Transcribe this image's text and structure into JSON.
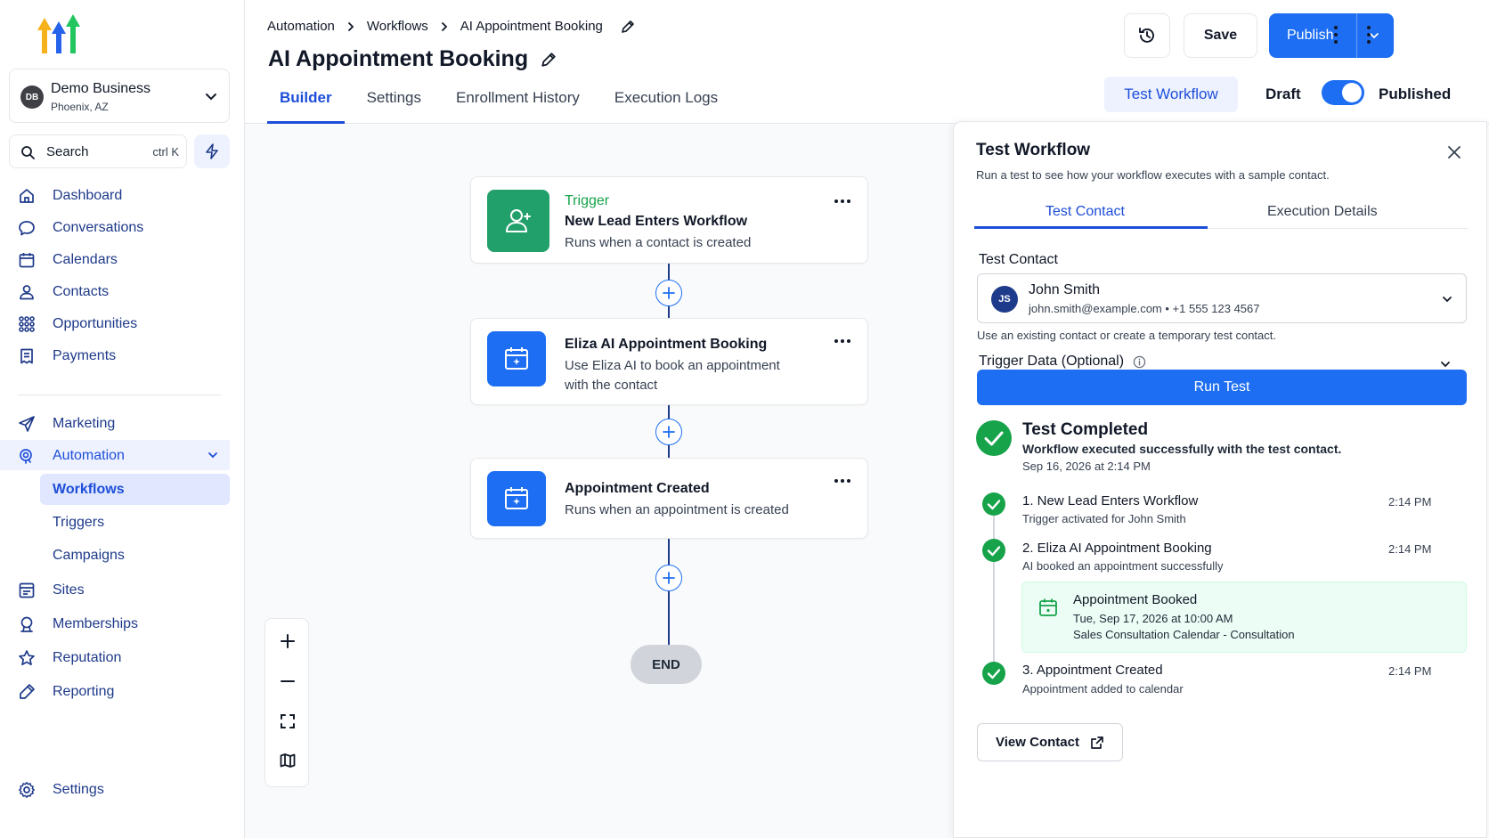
{
  "colors": {
    "accent": "#1d6ef2",
    "accent_text": "#1d4ed8",
    "nav_text": "#1e3a8a",
    "success": "#16a34a",
    "trigger_green": "#22a06b"
  },
  "sidebar": {
    "business": {
      "initials": "DB",
      "name": "Demo Business",
      "location": "Phoenix, AZ"
    },
    "search": {
      "label": "Search",
      "shortcut": "ctrl K"
    },
    "items": [
      {
        "label": "Dashboard",
        "icon": "home-icon"
      },
      {
        "label": "Conversations",
        "icon": "chat-icon"
      },
      {
        "label": "Calendars",
        "icon": "calendar-icon"
      },
      {
        "label": "Contacts",
        "icon": "contacts-icon"
      },
      {
        "label": "Opportunities",
        "icon": "opportunities-icon"
      },
      {
        "label": "Payments",
        "icon": "payments-icon"
      },
      {
        "label": "Marketing",
        "icon": "send-icon"
      },
      {
        "label": "Automation",
        "icon": "automation-icon"
      },
      {
        "label": "Sites",
        "icon": "sites-icon"
      },
      {
        "label": "Memberships",
        "icon": "membership-icon"
      },
      {
        "label": "Reputation",
        "icon": "star-icon"
      },
      {
        "label": "Reporting",
        "icon": "reporting-icon"
      },
      {
        "label": "Settings",
        "icon": "gear-icon"
      }
    ],
    "automation_sub": [
      "Workflows",
      "Triggers",
      "Campaigns"
    ]
  },
  "header": {
    "breadcrumbs": [
      "Automation",
      "Workflows",
      "AI Appointment Booking"
    ],
    "title": "AI Appointment Booking",
    "tabs": [
      "Builder",
      "Settings",
      "Enrollment History",
      "Execution Logs"
    ],
    "save_label": "Save",
    "publish_label": "Publish",
    "test_label": "Test Workflow",
    "draft_label": "Draft",
    "published_label": "Published"
  },
  "canvas": {
    "nodes": [
      {
        "kind": "Trigger",
        "title": "New Lead Enters Workflow",
        "desc": "Runs when a contact is created"
      },
      {
        "title": "Eliza AI Appointment Booking",
        "desc": "Use Eliza AI to book an appointment with the contact"
      },
      {
        "title": "Appointment Created",
        "desc": "Runs when an appointment is created"
      }
    ],
    "end_label": "END"
  },
  "panel": {
    "title": "Test Workflow",
    "subtitle": "Run a test to see how your workflow executes with a sample contact.",
    "tabs": [
      "Test Contact",
      "Execution Details"
    ],
    "contact_label": "Test Contact",
    "contact": {
      "initials": "JS",
      "name": "John Smith",
      "email": "john.smith@example.com • +1 555 123 4567"
    },
    "help": "Use an existing contact or create a temporary test contact.",
    "trigger_data_label": "Trigger Data (Optional)",
    "run_label": "Run Test",
    "result": {
      "title": "Test Completed",
      "subtitle": "Workflow executed successfully with the test contact.",
      "time": "Sep 16, 2026 at 2:14 PM"
    },
    "steps": [
      {
        "title": "1. New Lead Enters Workflow",
        "sub": "Trigger activated for John Smith",
        "time": "2:14 PM"
      },
      {
        "title": "2. Eliza AI Appointment Booking",
        "sub": "AI booked an appointment successfully",
        "time": "2:14 PM"
      },
      {
        "title": "3. Appointment Created",
        "sub": "Appointment added to calendar",
        "time": "2:14 PM"
      }
    ],
    "booked": {
      "title": "Appointment Booked",
      "when": "Tue, Sep 17, 2026 at 10:00 AM",
      "calendar": "Sales Consultation Calendar - Consultation"
    },
    "view_contact_label": "View Contact"
  }
}
